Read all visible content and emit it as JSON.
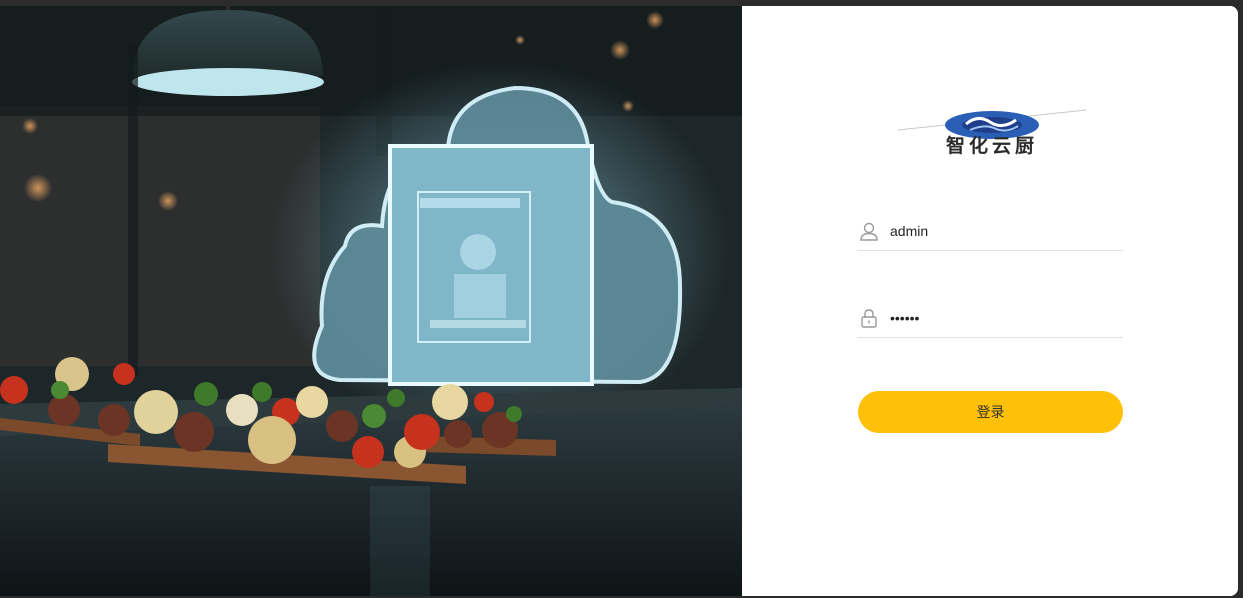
{
  "logo": {
    "text": "智化云厨"
  },
  "login": {
    "username_value": "admin",
    "password_value": "••••••",
    "submit_label": "登录"
  },
  "colors": {
    "accent": "#ffc107",
    "logo_blue": "#2a5fb5"
  },
  "icons": {
    "username": "user-icon",
    "password": "lock-icon"
  }
}
